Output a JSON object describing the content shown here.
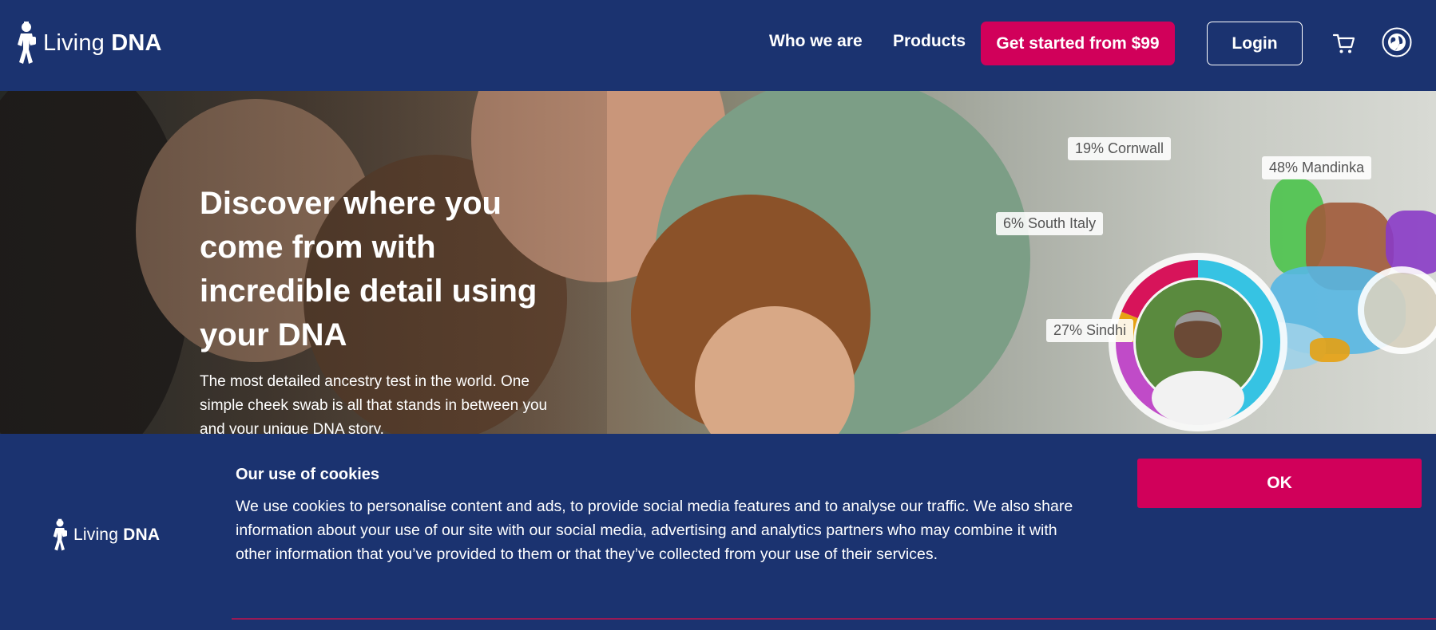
{
  "header": {
    "logo": {
      "text_light": "Living",
      "text_bold": "DNA"
    },
    "nav": {
      "who_we_are": "Who we are",
      "products": "Products"
    },
    "cta_label": "Get started from $99",
    "login_label": "Login",
    "icons": {
      "cart": "cart-icon",
      "globe": "globe-icon"
    }
  },
  "hero": {
    "title": "Discover where you come from with incredible detail using your DNA",
    "subtitle": "The most detailed ancestry test in the world. One simple cheek swab is all that stands in between you and your unique DNA story.",
    "ancestry_labels": [
      "19% Cornwall",
      "48% Mandinka",
      "6% South Italy",
      "27% Sindhi"
    ],
    "ancestry_breakdown": [
      {
        "label": "Mandinka",
        "percent": 48,
        "color": "#36c3e3"
      },
      {
        "label": "Sindhi",
        "percent": 27,
        "color": "#c04bc8"
      },
      {
        "label": "South Italy",
        "percent": 6,
        "color": "#e6a112"
      },
      {
        "label": "Cornwall",
        "percent": 19,
        "color": "#d7145a"
      }
    ]
  },
  "cookie_banner": {
    "logo": {
      "text_light": "Living",
      "text_bold": "DNA"
    },
    "title": "Our use of cookies",
    "body": "We use cookies to personalise content and ads, to provide social media features and to analyse our traffic. We also share information about your use of our site with our social media, advertising and analytics partners who may combine it with other information that you’ve provided to them or that they’ve collected from your use of their services.",
    "ok_label": "OK"
  },
  "colors": {
    "navy": "#1b3370",
    "brand_pink": "#d1005a"
  }
}
